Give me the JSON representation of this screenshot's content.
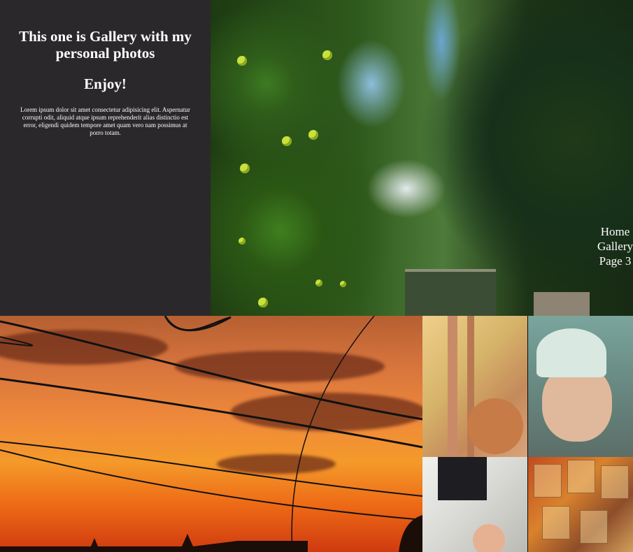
{
  "intro": {
    "heading": "This one is Gallery with my personal photos",
    "subheading": "Enjoy!",
    "body": "Lorem ipsum dolor sit amet consectetur adipisicing elit. Aspernatur corrupti odit, aliquid atque ipsum reprehenderit alias distinctio est error, eligendi quidem tempore amet quam vero nam possimus at porro totam."
  },
  "nav": {
    "items": [
      "Home",
      "Gallery",
      "Page 3"
    ]
  },
  "photos": {
    "hero": "apple-tree-photo",
    "sunset": "sunset-power-lines-photo",
    "tiles": [
      "child-window-photo",
      "child-hat-photo",
      "child-room-photo",
      "posters-wall-photo"
    ]
  }
}
